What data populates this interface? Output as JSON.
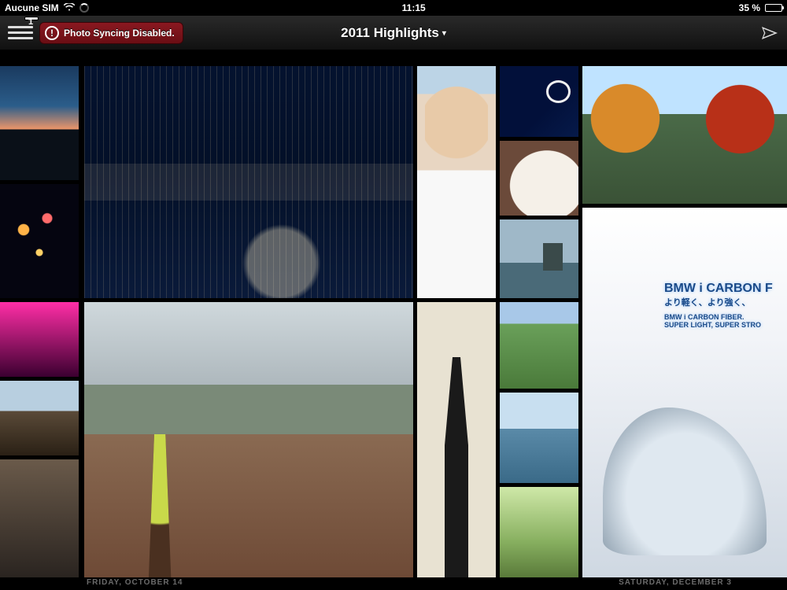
{
  "statusbar": {
    "carrier": "Aucune SIM",
    "time": "11:15",
    "battery_text": "35 %"
  },
  "appbar": {
    "menu_badge": "1",
    "sync_warning": "Photo Syncing Disabled.",
    "title": "2011 Highlights"
  },
  "dates": {
    "left": "FRIDAY, OCTOBER 14",
    "right": "SATURDAY, DECEMBER 3"
  },
  "bmw": {
    "line1": "BMW i CARBON F",
    "line2": "より軽く、より強く、",
    "line3": "BMW i CARBON FIBER.",
    "line4": "SUPER LIGHT, SUPER STRO"
  }
}
